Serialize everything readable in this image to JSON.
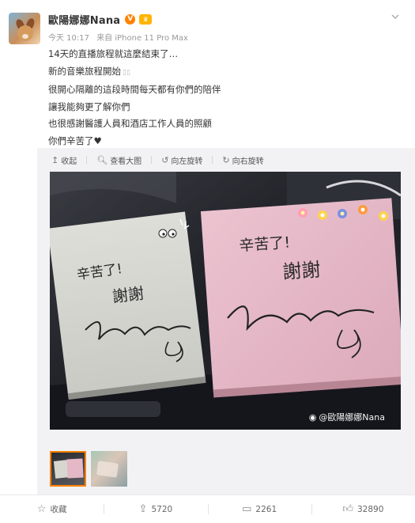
{
  "post": {
    "user_name": "歐陽娜娜Nana",
    "v_badge": "V",
    "time": "今天 10:17",
    "source": "来自 iPhone 11 Pro Max",
    "lines": [
      "14天的直播旅程就這麼結束了…",
      "新的音樂旅程開始",
      "很開心隔離的這段時間每天都有你們的陪伴",
      "讓我能夠更了解你們",
      "也很感謝醫護人員和酒店工作人員的照顧",
      "你們辛苦了♥"
    ]
  },
  "toolbar": {
    "collapse": "收起",
    "view_large": "查看大图",
    "rotate_left": "向左旋转",
    "rotate_right": "向右旋转"
  },
  "photo": {
    "note_left": {
      "line1": "辛苦了!",
      "line2": "謝謝",
      "signature": "Nana"
    },
    "note_right": {
      "line1": "辛苦了!",
      "line2": "謝謝",
      "signature": "Nana"
    },
    "watermark": "@歐陽娜娜Nana"
  },
  "footer": {
    "favorite": "收藏",
    "repost": "5720",
    "comment": "2261",
    "like": "32890"
  },
  "colors": {
    "accent": "#ff8200",
    "note_left": "#d6d6cf",
    "note_right": "#e4b7c6"
  }
}
